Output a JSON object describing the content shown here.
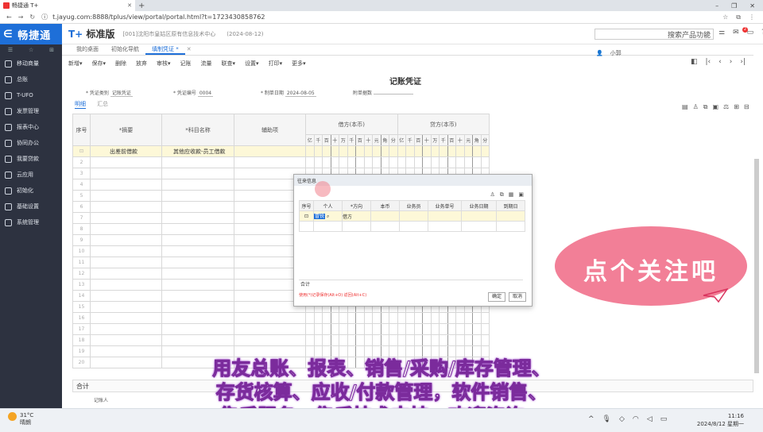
{
  "browser": {
    "tab_title": "畅捷通 T+",
    "url": "t.jayug.com:8888/tplus/view/portal/portal.html?t=1723430858762",
    "window_controls": [
      "–",
      "❐",
      "✕"
    ]
  },
  "sidebar": {
    "logo": "畅捷通",
    "tools": [
      "☰",
      "☆",
      "⊞"
    ],
    "items": [
      {
        "label": "移动商量",
        "icon": "chat-icon"
      },
      {
        "label": "总账",
        "icon": "ledger-icon"
      },
      {
        "label": "T-UFO",
        "icon": "report-icon"
      },
      {
        "label": "发票管理",
        "icon": "invoice-icon"
      },
      {
        "label": "报表中心",
        "icon": "chart-icon"
      },
      {
        "label": "协同办公",
        "icon": "collab-icon"
      },
      {
        "label": "我要贷款",
        "icon": "loan-icon"
      },
      {
        "label": "云应用",
        "icon": "cloud-icon"
      },
      {
        "label": "初始化",
        "icon": "init-icon"
      },
      {
        "label": "基础设置",
        "icon": "settings-icon"
      },
      {
        "label": "系统管理",
        "icon": "system-icon"
      }
    ]
  },
  "header": {
    "brand_t": "T+",
    "brand_name": "标准版",
    "company": "[001]沈阳市皇姑区原有信息技术中心",
    "date": "(2024-08-12)",
    "search_placeholder": "搜索产品功能",
    "badge": "2"
  },
  "page_tabs": [
    {
      "label": "我的桌面",
      "active": false
    },
    {
      "label": "初始化导航",
      "active": false
    },
    {
      "label": "填制凭证 *",
      "active": true
    }
  ],
  "user": "小郭",
  "toolbar": [
    "新增▾",
    "保存▾",
    "删除",
    "放弃",
    "审核▾",
    "记账",
    "流量",
    "联查▾",
    "设置▾",
    "打印▾",
    "更多▾"
  ],
  "voucher": {
    "title": "记账凭证",
    "type_label": "* 凭证类别",
    "type_value": "记账凭证",
    "no_label": "* 凭证编号",
    "no_value": "0004",
    "date_label": "* 制单日期",
    "date_value": "2024-08-05",
    "attach_label": "附单据数",
    "subtabs": [
      "明细",
      "汇总"
    ]
  },
  "grid": {
    "headers": {
      "seq": "序号",
      "summary": "*摘要",
      "account": "*科目名称",
      "aux": "辅助项",
      "debit": "借方(本币)",
      "credit": "贷方(本币)"
    },
    "digits": [
      "亿",
      "千",
      "百",
      "十",
      "万",
      "千",
      "百",
      "十",
      "元",
      "角",
      "分"
    ],
    "rows": [
      {
        "seq": "⊡",
        "summary": "出差前借款",
        "account": "其他应收款-员工借款"
      },
      {
        "seq": "2",
        "summary": "",
        "account": ""
      },
      {
        "seq": "3",
        "summary": "",
        "account": ""
      },
      {
        "seq": "4",
        "summary": "",
        "account": ""
      },
      {
        "seq": "5",
        "summary": "",
        "account": ""
      },
      {
        "seq": "6",
        "summary": "",
        "account": ""
      },
      {
        "seq": "7",
        "summary": "",
        "account": ""
      },
      {
        "seq": "8",
        "summary": "",
        "account": ""
      },
      {
        "seq": "9",
        "summary": "",
        "account": ""
      },
      {
        "seq": "10",
        "summary": "",
        "account": ""
      },
      {
        "seq": "11",
        "summary": "",
        "account": ""
      },
      {
        "seq": "12",
        "summary": "",
        "account": ""
      },
      {
        "seq": "13",
        "summary": "",
        "account": ""
      },
      {
        "seq": "14",
        "summary": "",
        "account": ""
      },
      {
        "seq": "15",
        "summary": "",
        "account": ""
      },
      {
        "seq": "16",
        "summary": "",
        "account": ""
      },
      {
        "seq": "17",
        "summary": "",
        "account": ""
      },
      {
        "seq": "18",
        "summary": "",
        "account": ""
      },
      {
        "seq": "19",
        "summary": "",
        "account": ""
      },
      {
        "seq": "20",
        "summary": "",
        "account": ""
      }
    ],
    "total_label": "合计",
    "maker_label": "记账人"
  },
  "dialog": {
    "title": "往来信息",
    "headers": [
      "序号",
      "个人",
      "*方向",
      "本币",
      "业务员",
      "业务单号",
      "业务日期",
      "到期日"
    ],
    "row": {
      "seq": "⊡",
      "person": "冒锐",
      "direction": "借方"
    },
    "sum_label": "合计",
    "hint": "使用(*)记录保存(Alt+O)  返回(Alt+C)",
    "ok": "确定",
    "cancel": "取消"
  },
  "promo": {
    "bubble": "点个关注吧",
    "caption_lines": [
      "用友总账、报表、销售/采购/库存管理、",
      "存货核算、应收/付款管理，软件销售、",
      "售后服务、售后技术支持，欢迎咨询。"
    ]
  },
  "taskbar": {
    "temp": "31°C",
    "weather": "晴朗",
    "time": "11:16",
    "date": "2024/8/12 星期一"
  }
}
